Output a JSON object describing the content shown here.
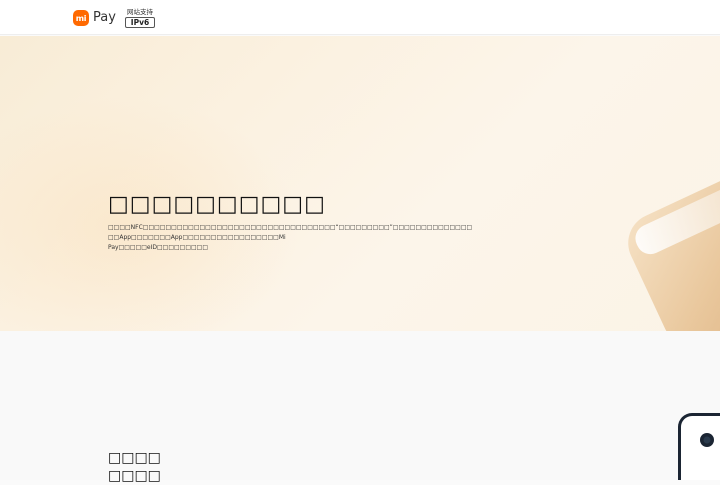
{
  "header": {
    "logo_icon": "mi-logo-icon",
    "logo_mark": "mi",
    "brand": "Pay",
    "ipv6_caption": "网站支持",
    "ipv6_badge": "IPv6",
    "accent_color": "#ff6900"
  },
  "hero": {
    "title": "□□□□□□□□□□",
    "description": "□□□□NFC□□□□□□□□□□□□□□□□□□□□□□□□□□□□□□□□□□“□□□□□□□□□”□□□□□□□□□□□□□□ □□App□□□□□□□App□□□□□□□□□□□□□□□□□Mi Pay□□□□□eID□□□□□□□□□"
  },
  "section2": {
    "title_line1": "□□□□",
    "title_line2": "□□□□"
  }
}
